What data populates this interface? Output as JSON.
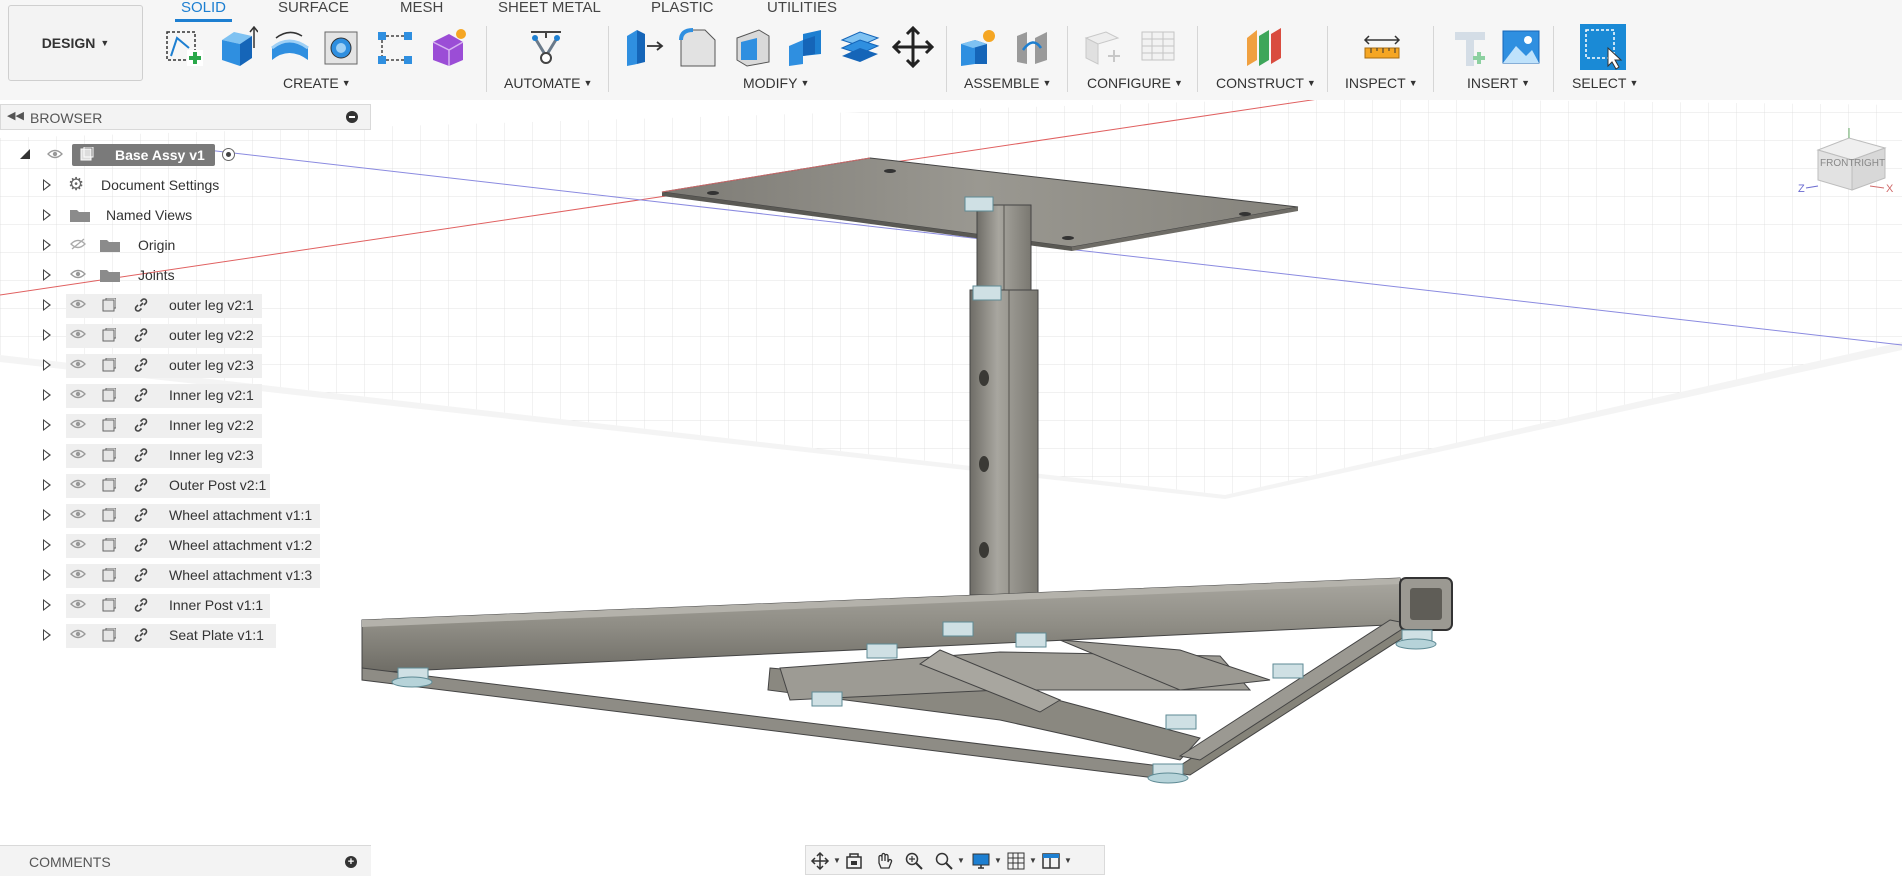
{
  "workspace": {
    "label": "DESIGN"
  },
  "tabs": [
    {
      "label": "SOLID"
    },
    {
      "label": "SURFACE"
    },
    {
      "label": "MESH"
    },
    {
      "label": "SHEET METAL"
    },
    {
      "label": "PLASTIC"
    },
    {
      "label": "UTILITIES"
    }
  ],
  "groups": {
    "create": "CREATE",
    "automate": "AUTOMATE",
    "modify": "MODIFY",
    "assemble": "ASSEMBLE",
    "configure": "CONFIGURE",
    "construct": "CONSTRUCT",
    "inspect": "INSPECT",
    "insert": "INSERT",
    "select": "SELECT"
  },
  "browser": {
    "title": "BROWSER",
    "root": "Base Assy v1",
    "items": [
      {
        "label": "Document Settings"
      },
      {
        "label": "Named Views"
      },
      {
        "label": "Origin"
      },
      {
        "label": "Joints"
      },
      {
        "label": "outer leg v2:1"
      },
      {
        "label": "outer leg v2:2"
      },
      {
        "label": "outer leg v2:3"
      },
      {
        "label": "Inner leg v2:1"
      },
      {
        "label": "Inner leg v2:2"
      },
      {
        "label": "Inner leg v2:3"
      },
      {
        "label": "Outer Post v2:1"
      },
      {
        "label": "Wheel attachment v1:1"
      },
      {
        "label": "Wheel attachment v1:2"
      },
      {
        "label": "Wheel attachment v1:3"
      },
      {
        "label": "Inner Post v1:1"
      },
      {
        "label": "Seat Plate v1:1"
      }
    ]
  },
  "viewcube": {
    "front": "FRONT",
    "right": "RIGHT",
    "axis_z": "Z",
    "axis_x": "X"
  },
  "comments": {
    "label": "COMMENTS"
  },
  "colors": {
    "accent": "#1d7fd1",
    "steel": "#8f8d85"
  }
}
